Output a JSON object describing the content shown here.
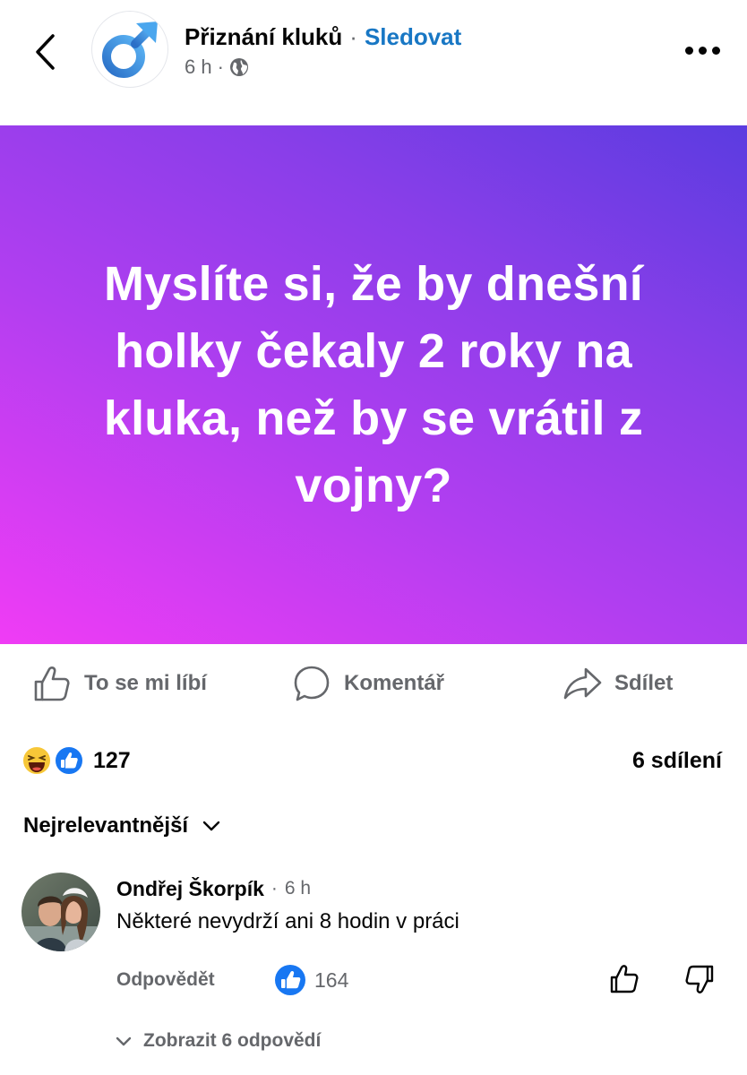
{
  "header": {
    "page_name": "Přiznání kluků",
    "separator": "·",
    "follow_label": "Sledovat",
    "time_ago": "6 h",
    "meta_separator": "·",
    "audience_icon": "globe-icon"
  },
  "post": {
    "text": "Myslíte si, že by dnešní holky čekaly 2 roky na kluka, než by se vrátil z vojny?",
    "background_gradient": [
      "#f03cf5",
      "#5b3ce0"
    ]
  },
  "actions": {
    "like_label": "To se mi líbí",
    "comment_label": "Komentář",
    "share_label": "Sdílet"
  },
  "reactions": {
    "icons": [
      "haha-icon",
      "like-icon"
    ],
    "count": "127",
    "shares": "6 sdílení"
  },
  "sort": {
    "label": "Nejrelevantnější"
  },
  "comment": {
    "author": "Ondřej Škorpík",
    "time_sep": "·",
    "time": "6 h",
    "text": "Některé nevydrží ani 8 hodin v práci",
    "reply_label": "Odpovědět",
    "like_count": "164",
    "view_replies_label": "Zobrazit 6 odpovědí"
  },
  "colors": {
    "accent_blue": "#1877c4",
    "muted_text": "#65676b",
    "text": "#050505"
  }
}
